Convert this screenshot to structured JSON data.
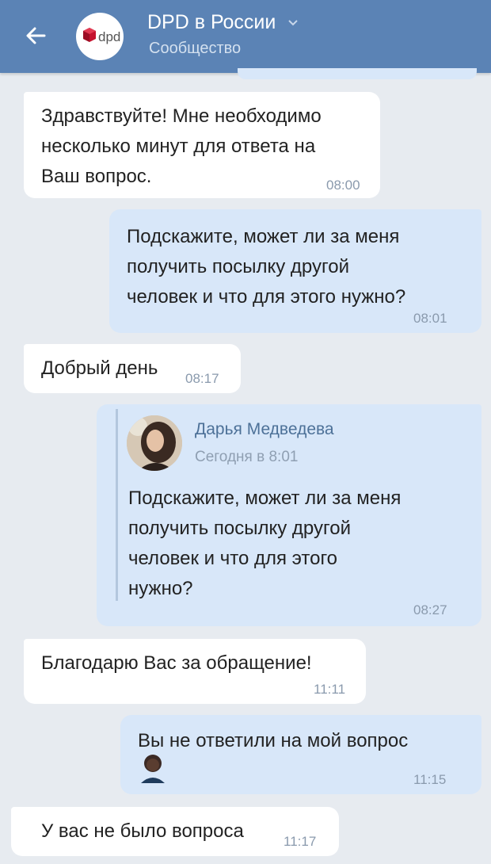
{
  "header": {
    "title": "DPD в России",
    "subtitle": "Сообщество",
    "logo_text": "dpd"
  },
  "messages": [
    {
      "text": "Здравствуйте! Мне необходимо\nнесколько минут для ответа на\nВаш вопрос.",
      "time": "08:00"
    },
    {
      "text": "Подскажите, может ли за меня\nполучить посылку другой\nчеловек и что для этого нужно?",
      "time": "08:01"
    },
    {
      "text": "Добрый день",
      "time": "08:17"
    },
    {
      "text": "",
      "time": "08:27",
      "quote": {
        "author": "Дарья Медведева",
        "date": "Сегодня в 8:01",
        "text": "Подскажите, может ли за меня\nполучить посылку другой\nчеловек и что для этого\nнужно?"
      }
    },
    {
      "text": "Благодарю Вас за обращение!",
      "time": "11:11"
    },
    {
      "text": "Вы не ответили на мой вопрос",
      "time": "11:15"
    },
    {
      "text": "У вас не было вопроса",
      "time": "11:17"
    }
  ],
  "colors": {
    "header": "#5b83b5",
    "incoming": "#ffffff",
    "outgoing": "#d8e7f9",
    "background": "#e7ebf0"
  }
}
